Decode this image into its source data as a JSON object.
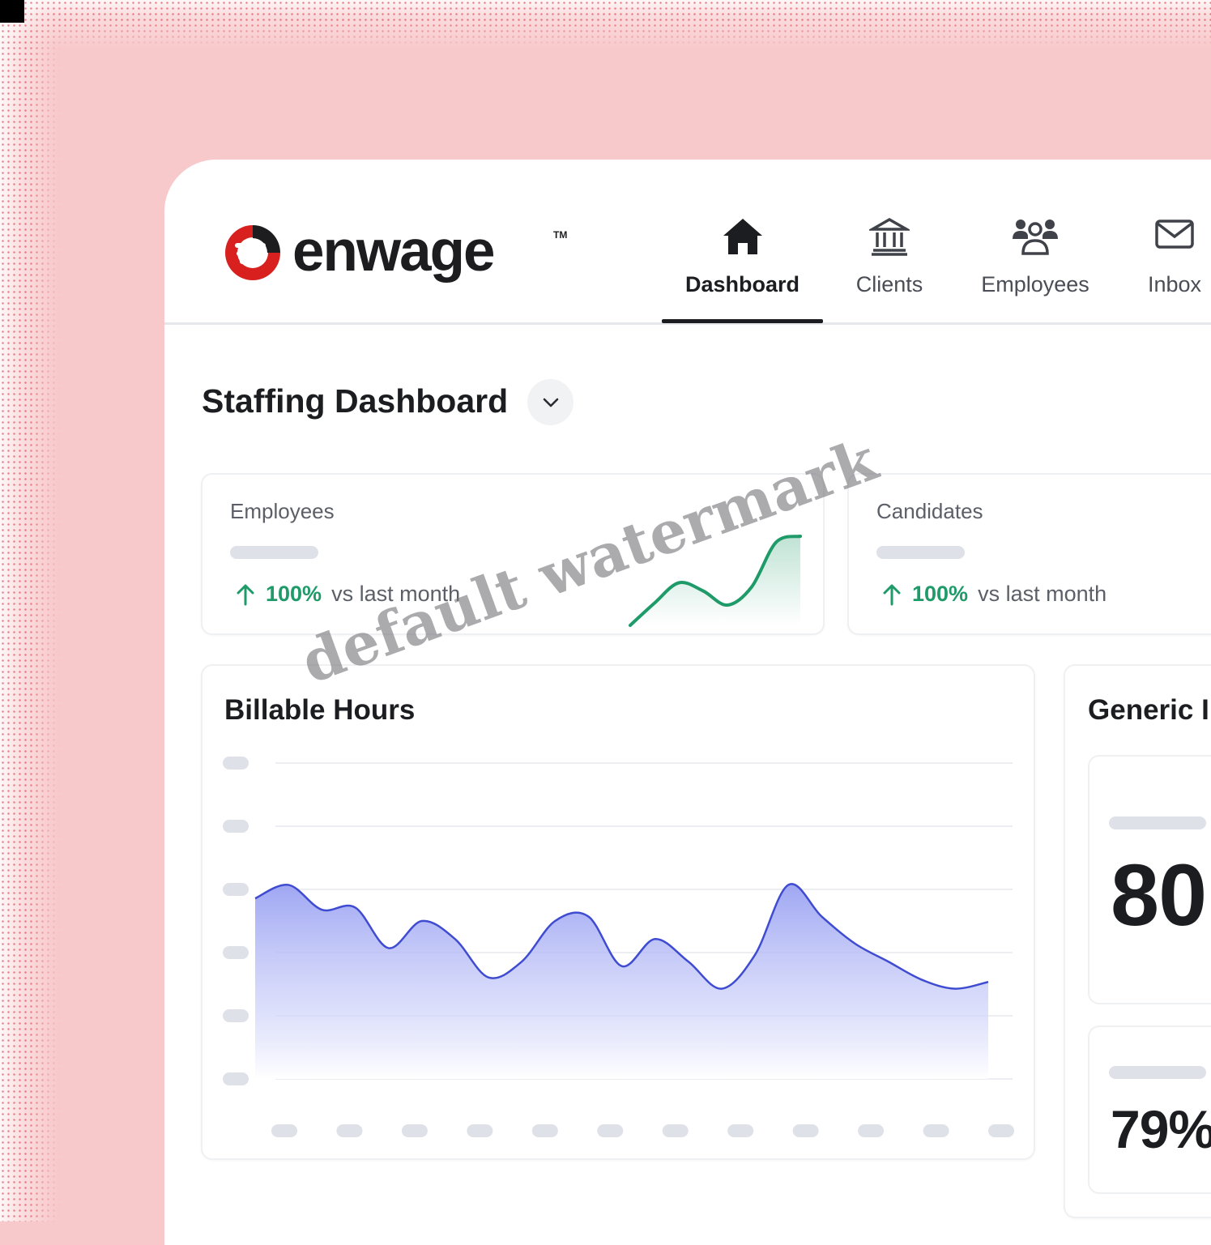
{
  "brand": {
    "name": "enwage",
    "trademark": "TM"
  },
  "nav": {
    "items": [
      {
        "label": "Dashboard",
        "icon": "home-icon",
        "active": true
      },
      {
        "label": "Clients",
        "icon": "bank-icon",
        "active": false
      },
      {
        "label": "Employees",
        "icon": "people-icon",
        "active": false
      },
      {
        "label": "Inbox",
        "icon": "mail-icon",
        "active": false
      }
    ]
  },
  "page": {
    "title": "Staffing Dashboard"
  },
  "stats": [
    {
      "label": "Employees",
      "change": "100%",
      "context": "vs last month",
      "trend": "up"
    },
    {
      "label": "Candidates",
      "change": "100%",
      "context": "vs last month",
      "trend": "up"
    }
  ],
  "billable": {
    "title": "Billable Hours"
  },
  "side_panel": {
    "title": "Generic I",
    "metrics": [
      {
        "value": "80"
      },
      {
        "value": "79%"
      }
    ]
  },
  "watermark": "default watermark",
  "colors": {
    "accent_green": "#1f9a69",
    "chart_line": "#3f4cd1",
    "chart_fill": "#a7aef4",
    "brand_red": "#d8211f",
    "background": "#f8c9cb"
  },
  "chart_data": [
    {
      "type": "area",
      "title": "Billable Hours",
      "x": [
        0,
        1,
        2,
        3,
        4,
        5,
        6,
        7,
        8,
        9,
        10,
        11,
        12,
        13,
        14,
        15,
        16,
        17,
        18,
        19,
        20,
        21,
        22
      ],
      "values": [
        80,
        86,
        75,
        76,
        58,
        70,
        62,
        45,
        52,
        70,
        72,
        50,
        62,
        52,
        40,
        55,
        86,
        72,
        60,
        52,
        44,
        40,
        43
      ],
      "ylim": [
        0,
        140
      ],
      "grid": true,
      "axis_labels_visible": false
    },
    {
      "type": "line",
      "series_of": "Employees",
      "values": [
        10,
        32,
        52,
        44,
        30,
        48,
        92,
        98
      ]
    }
  ]
}
